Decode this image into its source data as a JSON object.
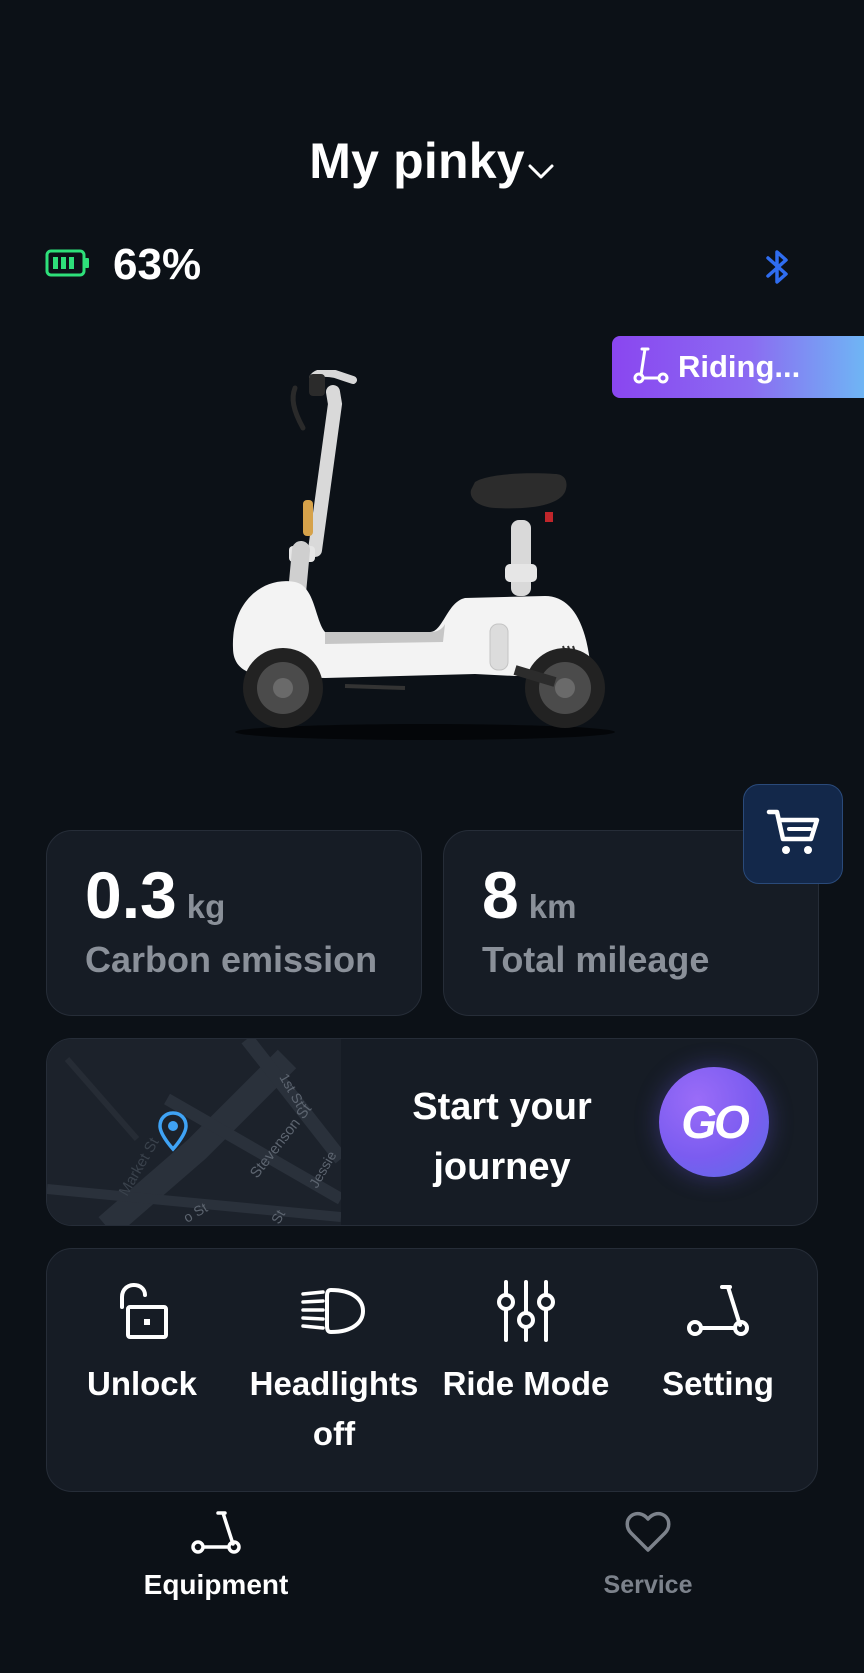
{
  "header": {
    "title": "My pinky",
    "dropdown_icon": "chevron-down-icon"
  },
  "status": {
    "battery_percent": "63%",
    "battery_icon": "battery-icon",
    "battery_color": "#2ee07a",
    "bluetooth_icon": "bluetooth-icon",
    "bluetooth_color": "#2f6df0",
    "riding_badge": "Riding..."
  },
  "vehicle": {
    "image": "scooter-image"
  },
  "shop": {
    "icon": "cart-icon"
  },
  "stats": {
    "carbon": {
      "value": "0.3",
      "unit": "kg",
      "label": "Carbon emission"
    },
    "mileage": {
      "value": "8",
      "unit": "km",
      "label": "Total mileage"
    }
  },
  "journey": {
    "map_streets": [
      "1st St",
      "Stevenson St",
      "Market St",
      "Jessie",
      "St",
      "o St"
    ],
    "text": "Start your journey",
    "go_label": "GO"
  },
  "controls": [
    {
      "label": "Unlock",
      "icon": "unlock-icon"
    },
    {
      "label": "Headlights off",
      "icon": "headlight-icon"
    },
    {
      "label": "Ride Mode",
      "icon": "sliders-icon"
    },
    {
      "label": "Setting",
      "icon": "scooter-icon"
    }
  ],
  "tabs": [
    {
      "label": "Equipment",
      "icon": "scooter-icon",
      "active": true
    },
    {
      "label": "Service",
      "icon": "heart-icon",
      "active": false
    }
  ],
  "colors": {
    "background": "#0c1117",
    "card": "#161c25",
    "muted_text": "#8a9099",
    "accent_purple": "#8a46f0"
  }
}
